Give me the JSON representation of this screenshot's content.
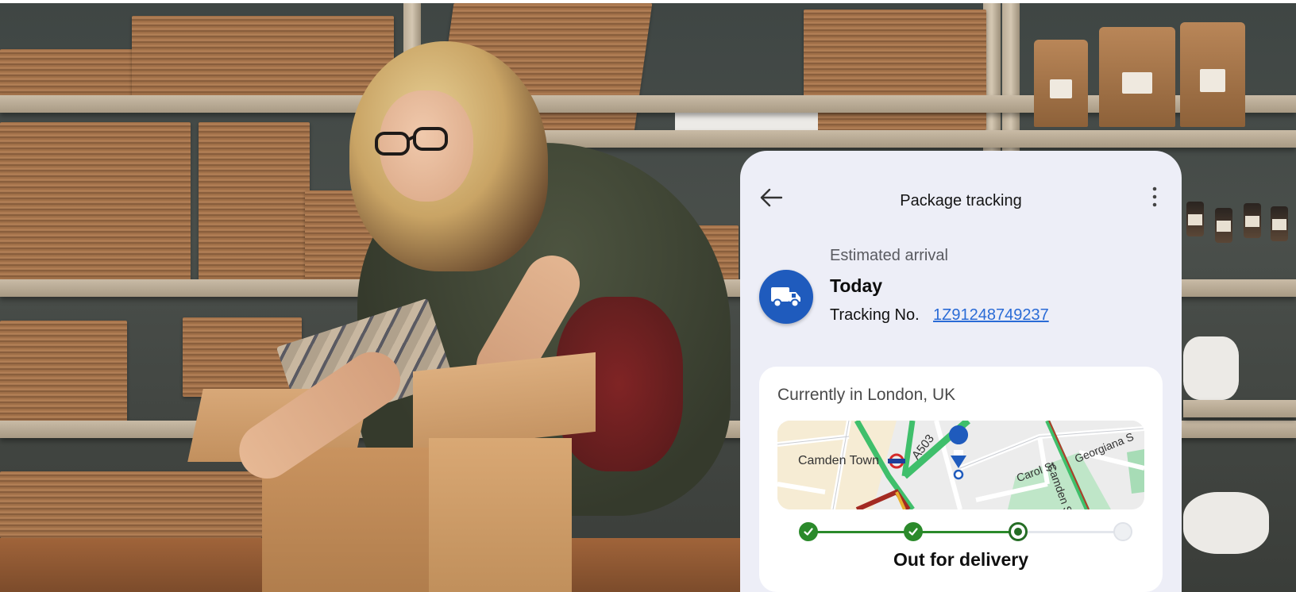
{
  "header": {
    "title": "Package tracking",
    "back_icon": "arrow-left-icon",
    "more_icon": "more-vertical-icon"
  },
  "shipment": {
    "icon": "delivery-truck-icon",
    "eta_label": "Estimated arrival",
    "eta_value": "Today",
    "tracking_label": "Tracking No.",
    "tracking_number": "1Z91248749237"
  },
  "status": {
    "location": "Currently in London, UK",
    "map_labels": {
      "camden_town": "Camden Town",
      "a503": "A503",
      "carol_st": "Carol St",
      "georgiana_st": "Georgiana S",
      "camden_st": "Camden S"
    },
    "steps_total": 4,
    "steps_completed": 2,
    "current_step": 3,
    "current_status": "Out for delivery"
  },
  "colors": {
    "brand_blue": "#1f5bbd",
    "progress_green": "#2b8a2b",
    "link_blue": "#2a6bd6",
    "card_bg": "#edeef7"
  }
}
